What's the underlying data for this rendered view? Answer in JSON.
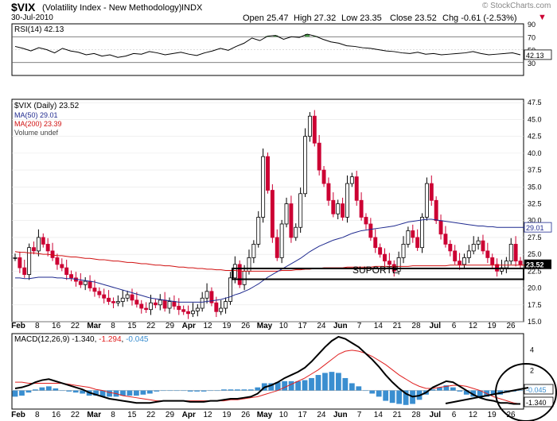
{
  "header": {
    "symbol": "$VIX",
    "name": "(Volatility Index - New Methodology)",
    "exchange": "INDX",
    "date": "30-Jul-2010",
    "open": "Open 25.47",
    "high": "High 27.32",
    "low": "Low 23.35",
    "close": "Close 23.52",
    "chg": "Chg -0.61 (-2.53%)",
    "chg_arrow": "▼",
    "watermark": "© StockCharts.com"
  },
  "colors": {
    "up_candle": "#ffffff",
    "down_candle": "#cc0033",
    "ma50": "#1f2a8f",
    "ma200": "#d01010",
    "macd_line": "#000000",
    "signal_line": "#e02020",
    "histogram": "#3a8ed0",
    "rsi_overbought_fill": "#4a9a4a"
  },
  "chart_data": [
    {
      "type": "line",
      "panel": "RSI",
      "label": "RSI(14) 42.13",
      "last_value_label": "42.13",
      "y_ticks": [
        "90",
        "70",
        "50",
        "30"
      ],
      "ylim": [
        10,
        90
      ],
      "values": [
        55,
        52,
        48,
        53,
        50,
        45,
        52,
        48,
        46,
        42,
        44,
        40,
        42,
        38,
        40,
        44,
        43,
        47,
        45,
        42,
        44,
        46,
        43,
        41,
        45,
        48,
        52,
        49,
        55,
        60,
        68,
        64,
        71,
        72,
        66,
        70,
        69,
        74,
        71,
        66,
        62,
        60,
        56,
        55,
        53,
        52,
        50,
        48,
        47,
        45,
        44,
        46,
        43,
        44,
        42,
        43,
        44,
        45,
        47,
        44,
        42,
        43,
        44,
        45,
        42
      ]
    },
    {
      "type": "candlestick",
      "panel": "price",
      "title": "$VIX (Daily) 23.52",
      "legend": [
        "MA(50) 29.01",
        "MA(200) 23.39",
        "Volume undef"
      ],
      "y_ticks": [
        "47.5",
        "45.0",
        "42.5",
        "40.0",
        "37.5",
        "35.0",
        "32.5",
        "30.0",
        "27.5",
        "25.0",
        "22.5",
        "20.0",
        "17.5",
        "15.0"
      ],
      "ylim": [
        15,
        48
      ],
      "x_ticks": [
        "Feb",
        "8",
        "16",
        "22",
        "Mar",
        "8",
        "15",
        "22",
        "29",
        "Apr",
        "12",
        "19",
        "26",
        "May",
        "10",
        "17",
        "24",
        "Jun",
        "7",
        "14",
        "21",
        "28",
        "Jul",
        "6",
        "12",
        "19",
        "26"
      ],
      "last_price_label": "23.52",
      "ma50_label": "29.01",
      "annotation": "SUPORTE",
      "support_zone": [
        21.3,
        22.9
      ],
      "closes": [
        24.5,
        23.0,
        22.0,
        26.0,
        25.5,
        27.5,
        26.5,
        25.5,
        24.5,
        23.5,
        23.0,
        22.0,
        21.5,
        21.0,
        20.5,
        21.0,
        20.0,
        19.5,
        19.0,
        18.5,
        18.0,
        17.8,
        18.0,
        18.5,
        19.0,
        18.2,
        17.6,
        17.0,
        16.8,
        17.8,
        17.5,
        18.2,
        17.0,
        18.0,
        17.3,
        16.8,
        16.5,
        16.2,
        16.6,
        17.0,
        18.5,
        19.5,
        17.8,
        16.5,
        17.0,
        18.0,
        21.5,
        23.5,
        20.5,
        22.5,
        24.5,
        26.5,
        30.5,
        39.5,
        34.5,
        27.5,
        24.5,
        29.5,
        32.5,
        27.5,
        29.0,
        34.0,
        42.5,
        45.5,
        41.5,
        37.5,
        35.5,
        33.0,
        31.0,
        32.5,
        30.5,
        35.5,
        36.5,
        33.0,
        30.5,
        29.5,
        27.5,
        26.0,
        25.0,
        24.0,
        23.5,
        22.5,
        24.5,
        26.5,
        28.5,
        27.5,
        26.0,
        30.5,
        35.5,
        33.0,
        30.0,
        28.0,
        26.5,
        25.5,
        24.0,
        23.5,
        24.5,
        25.5,
        26.5,
        27.0,
        25.5,
        24.5,
        23.5,
        22.5,
        23.0,
        24.0,
        26.5,
        24.0,
        23.5
      ],
      "ma50": [
        21.5,
        21.5,
        21.4,
        21.4,
        21.5,
        21.6,
        21.6,
        21.6,
        21.6,
        21.5,
        21.5,
        21.4,
        21.4,
        21.3,
        21.2,
        21.1,
        21.0,
        20.9,
        20.7,
        20.5,
        20.3,
        20.1,
        19.9,
        19.7,
        19.5,
        19.3,
        19.1,
        18.9,
        18.7,
        18.5,
        18.4,
        18.3,
        18.2,
        18.1,
        18.0,
        17.9,
        17.9,
        17.9,
        17.9,
        17.9,
        17.9,
        18.0,
        18.1,
        18.2,
        18.3,
        18.5,
        18.7,
        19.0,
        19.2,
        19.5,
        19.8,
        20.2,
        20.6,
        21.1,
        21.6,
        22.0,
        22.4,
        22.8,
        23.2,
        23.6,
        24.0,
        24.4,
        24.9,
        25.4,
        25.8,
        26.2,
        26.5,
        26.8,
        27.1,
        27.3,
        27.5,
        27.8,
        28.1,
        28.3,
        28.5,
        28.6,
        28.7,
        28.8,
        28.9,
        29.0,
        29.1,
        29.2,
        29.4,
        29.6,
        29.8,
        29.9,
        30.0,
        30.1,
        30.2,
        30.2,
        30.1,
        30.0,
        29.9,
        29.8,
        29.7,
        29.6,
        29.5,
        29.4,
        29.3,
        29.2,
        29.2,
        29.1,
        29.1,
        29.0,
        29.0,
        29.0,
        29.0,
        29.0,
        29.0,
        29.0,
        29.0
      ],
      "ma200": [
        25.4,
        25.3,
        25.3,
        25.2,
        25.2,
        25.1,
        25.0,
        25.0,
        24.9,
        24.8,
        24.8,
        24.7,
        24.6,
        24.6,
        24.5,
        24.4,
        24.4,
        24.3,
        24.2,
        24.2,
        24.1,
        24.0,
        24.0,
        23.9,
        23.8,
        23.8,
        23.7,
        23.6,
        23.6,
        23.5,
        23.4,
        23.4,
        23.3,
        23.3,
        23.2,
        23.1,
        23.1,
        23.0,
        23.0,
        22.9,
        22.9,
        22.8,
        22.8,
        22.7,
        22.7,
        22.6,
        22.6,
        22.6,
        22.5,
        22.5,
        22.5,
        22.5,
        22.5,
        22.5,
        22.5,
        22.5,
        22.5,
        22.6,
        22.6,
        22.6,
        22.7,
        22.7,
        22.8,
        22.8,
        22.9,
        22.9,
        23.0,
        23.0,
        23.0,
        23.0,
        23.0,
        23.1,
        23.1,
        23.1,
        23.1,
        23.1,
        23.1,
        23.2,
        23.2,
        23.2,
        23.2,
        23.2,
        23.2,
        23.2,
        23.2,
        23.3,
        23.3,
        23.3,
        23.3,
        23.3,
        23.3,
        23.3,
        23.3,
        23.4,
        23.4,
        23.4,
        23.4,
        23.4,
        23.4,
        23.4,
        23.4,
        23.4,
        23.4,
        23.4,
        23.4,
        23.4,
        23.4,
        23.4,
        23.4,
        23.4,
        23.4
      ]
    },
    {
      "type": "line",
      "panel": "MACD",
      "label_prefix": "MACD(12,26,9)",
      "label_macd": "-1.340",
      "label_signal": "-1.294",
      "label_hist": "-0.045",
      "y_ticks": [
        "4",
        "2",
        "0"
      ],
      "ylim": [
        -1.8,
        5.5
      ],
      "signal_label": "-0.045",
      "macd_label": "-1.340",
      "macd": [
        0.2,
        0.3,
        0.5,
        0.8,
        1.0,
        1.1,
        0.9,
        0.7,
        0.5,
        0.3,
        0.1,
        -0.2,
        -0.4,
        -0.6,
        -0.8,
        -0.9,
        -1.0,
        -1.1,
        -1.2,
        -1.2,
        -1.2,
        -1.1,
        -1.0,
        -1.0,
        -1.0,
        -1.0,
        -1.1,
        -1.1,
        -1.1,
        -1.0,
        -1.0,
        -0.9,
        -0.8,
        -0.8,
        -0.7,
        -0.6,
        -0.3,
        0.3,
        0.5,
        0.8,
        1.2,
        1.5,
        1.8,
        2.2,
        2.8,
        3.5,
        4.2,
        4.8,
        5.2,
        5.0,
        4.6,
        4.2,
        3.6,
        3.0,
        2.3,
        1.5,
        0.8,
        0.2,
        -0.3,
        -0.6,
        -0.5,
        -0.2,
        0.3,
        0.6,
        0.9,
        0.8,
        0.4,
        0.0,
        -0.4,
        -0.7,
        -0.9,
        -1.0,
        -1.2,
        -1.2,
        -1.3,
        -1.3
      ],
      "signal": [
        0.8,
        0.8,
        0.7,
        0.7,
        0.7,
        0.7,
        0.7,
        0.7,
        0.6,
        0.5,
        0.4,
        0.3,
        0.1,
        0.0,
        -0.2,
        -0.3,
        -0.5,
        -0.6,
        -0.7,
        -0.8,
        -0.9,
        -1.0,
        -1.0,
        -1.0,
        -1.0,
        -1.0,
        -1.0,
        -1.0,
        -1.0,
        -1.0,
        -1.0,
        -1.0,
        -0.9,
        -0.9,
        -0.8,
        -0.7,
        -0.6,
        -0.4,
        -0.2,
        0.0,
        0.3,
        0.6,
        0.9,
        1.2,
        1.6,
        2.0,
        2.5,
        3.0,
        3.5,
        3.8,
        3.9,
        3.8,
        3.6,
        3.3,
        2.9,
        2.5,
        2.0,
        1.5,
        1.1,
        0.7,
        0.4,
        0.2,
        0.2,
        0.3,
        0.4,
        0.5,
        0.5,
        0.4,
        0.2,
        0.0,
        -0.3,
        -0.6,
        -0.8,
        -1.0,
        -1.2,
        -1.3
      ]
    }
  ]
}
